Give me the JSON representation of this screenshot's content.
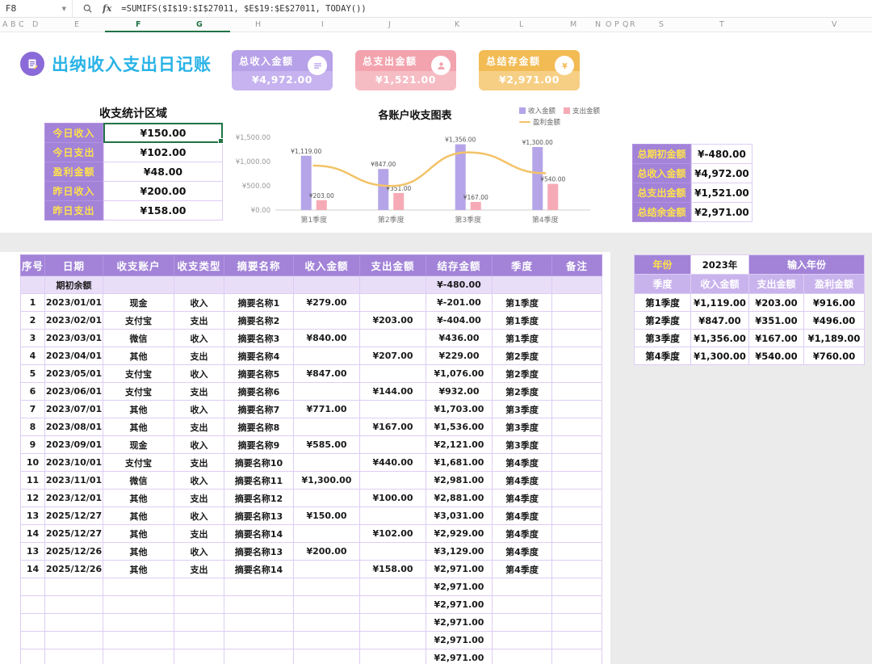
{
  "formula_bar": {
    "cell_ref": "F8",
    "formula": "=SUMIFS($I$19:$I$27011, $E$19:$E$27011, TODAY())"
  },
  "column_letters": [
    "A",
    "B",
    "C",
    "D",
    "E",
    "F",
    "G",
    "H",
    "I",
    "J",
    "K",
    "L",
    "M",
    "N",
    "O",
    "P",
    "Q",
    "R",
    "S",
    "T",
    "V"
  ],
  "selected_columns": [
    "F",
    "G"
  ],
  "title": "出纳收入支出日记账",
  "theme": {
    "header_purple": "#a283d8",
    "label_yellow": "#ffe14d",
    "selection_green": "#217346",
    "title_cyan": "#29b3e6",
    "light_purple_border": "#ddcdf4",
    "light_purple_row": "#e9def8"
  },
  "summary_cards": [
    {
      "label": "总收入金额",
      "value": "¥4,972.00",
      "color": "#b7a1e8",
      "color2": "#c6b3ef",
      "icon": "list-icon"
    },
    {
      "label": "总支出金额",
      "value": "¥1,521.00",
      "color": "#f2a3ae",
      "color2": "#f6bcc4",
      "icon": "person-icon"
    },
    {
      "label": "总结存金额",
      "value": "¥2,971.00",
      "color": "#f2bb54",
      "color2": "#f6cf85",
      "icon": "money-icon"
    }
  ],
  "stats": {
    "title": "收支统计区域",
    "rows": [
      {
        "label": "今日收入",
        "value": "¥150.00",
        "selected": true
      },
      {
        "label": "今日支出",
        "value": "¥102.00",
        "selected": false
      },
      {
        "label": "盈利金额",
        "value": "¥48.00",
        "selected": false
      },
      {
        "label": "昨日收入",
        "value": "¥200.00",
        "selected": false
      },
      {
        "label": "昨日支出",
        "value": "¥158.00",
        "selected": false
      }
    ]
  },
  "chart_data": {
    "type": "bar",
    "title": "各账户收支图表",
    "categories": [
      "第1季度",
      "第2季度",
      "第3季度",
      "第4季度"
    ],
    "series": [
      {
        "name": "收入金额",
        "kind": "bar",
        "color": "#b5a5e8",
        "values": [
          1119,
          847,
          1356,
          1300
        ],
        "labels": [
          "¥1,119.00",
          "¥847.00",
          "¥1,356.00",
          "¥1,300.00"
        ]
      },
      {
        "name": "支出金额",
        "kind": "bar",
        "color": "#f6aab6",
        "values": [
          203,
          351,
          167,
          540
        ],
        "labels": [
          "¥203.00",
          "¥351.00",
          "¥167.00",
          "¥540.00"
        ]
      },
      {
        "name": "盈利金额",
        "kind": "line",
        "color": "#f3c368",
        "values": [
          916,
          496,
          1189,
          760
        ]
      }
    ],
    "y_ticks": [
      "¥1,500.00",
      "¥1,000.00",
      "¥500.00",
      "¥0.00"
    ],
    "y_tick_values": [
      1500,
      1000,
      500,
      0
    ],
    "ylim": [
      0,
      1500
    ],
    "legend_position": "top-right",
    "grid": false
  },
  "totals_table": {
    "rows": [
      {
        "label": "总期初金额",
        "value": "¥-480.00"
      },
      {
        "label": "总收入金额",
        "value": "¥4,972.00"
      },
      {
        "label": "总支出金额",
        "value": "¥1,521.00"
      },
      {
        "label": "总结余金额",
        "value": "¥2,971.00"
      }
    ]
  },
  "quarter_table": {
    "year_label": "年份",
    "year_value": "2023年",
    "input_label": "输入年份",
    "headers": [
      "季度",
      "收入金额",
      "支出金额",
      "盈利金额"
    ],
    "rows": [
      [
        "第1季度",
        "¥1,119.00",
        "¥203.00",
        "¥916.00"
      ],
      [
        "第2季度",
        "¥847.00",
        "¥351.00",
        "¥496.00"
      ],
      [
        "第3季度",
        "¥1,356.00",
        "¥167.00",
        "¥1,189.00"
      ],
      [
        "第4季度",
        "¥1,300.00",
        "¥540.00",
        "¥760.00"
      ]
    ]
  },
  "main_table": {
    "headers": [
      "序号",
      "日期",
      "收支账户",
      "收支类型",
      "摘要名称",
      "收入金额",
      "支出金额",
      "结存金额",
      "季度",
      "备注"
    ],
    "opening_row": {
      "label": "期初余额",
      "balance": "¥-480.00"
    },
    "rows": [
      [
        "1",
        "2023/01/01",
        "现金",
        "收入",
        "摘要名称1",
        "¥279.00",
        "",
        "¥-201.00",
        "第1季度",
        ""
      ],
      [
        "2",
        "2023/02/01",
        "支付宝",
        "支出",
        "摘要名称2",
        "",
        "¥203.00",
        "¥-404.00",
        "第1季度",
        ""
      ],
      [
        "3",
        "2023/03/01",
        "微信",
        "收入",
        "摘要名称3",
        "¥840.00",
        "",
        "¥436.00",
        "第1季度",
        ""
      ],
      [
        "4",
        "2023/04/01",
        "其他",
        "支出",
        "摘要名称4",
        "",
        "¥207.00",
        "¥229.00",
        "第2季度",
        ""
      ],
      [
        "5",
        "2023/05/01",
        "支付宝",
        "收入",
        "摘要名称5",
        "¥847.00",
        "",
        "¥1,076.00",
        "第2季度",
        ""
      ],
      [
        "6",
        "2023/06/01",
        "支付宝",
        "支出",
        "摘要名称6",
        "",
        "¥144.00",
        "¥932.00",
        "第2季度",
        ""
      ],
      [
        "7",
        "2023/07/01",
        "其他",
        "收入",
        "摘要名称7",
        "¥771.00",
        "",
        "¥1,703.00",
        "第3季度",
        ""
      ],
      [
        "8",
        "2023/08/01",
        "其他",
        "支出",
        "摘要名称8",
        "",
        "¥167.00",
        "¥1,536.00",
        "第3季度",
        ""
      ],
      [
        "9",
        "2023/09/01",
        "现金",
        "收入",
        "摘要名称9",
        "¥585.00",
        "",
        "¥2,121.00",
        "第3季度",
        ""
      ],
      [
        "10",
        "2023/10/01",
        "支付宝",
        "支出",
        "摘要名称10",
        "",
        "¥440.00",
        "¥1,681.00",
        "第4季度",
        ""
      ],
      [
        "11",
        "2023/11/01",
        "微信",
        "收入",
        "摘要名称11",
        "¥1,300.00",
        "",
        "¥2,981.00",
        "第4季度",
        ""
      ],
      [
        "12",
        "2023/12/01",
        "其他",
        "支出",
        "摘要名称12",
        "",
        "¥100.00",
        "¥2,881.00",
        "第4季度",
        ""
      ],
      [
        "13",
        "2025/12/27",
        "其他",
        "收入",
        "摘要名称13",
        "¥150.00",
        "",
        "¥3,031.00",
        "第4季度",
        ""
      ],
      [
        "14",
        "2025/12/27",
        "其他",
        "支出",
        "摘要名称14",
        "",
        "¥102.00",
        "¥2,929.00",
        "第4季度",
        ""
      ],
      [
        "13",
        "2025/12/26",
        "其他",
        "收入",
        "摘要名称13",
        "¥200.00",
        "",
        "¥3,129.00",
        "第4季度",
        ""
      ],
      [
        "14",
        "2025/12/26",
        "其他",
        "支出",
        "摘要名称14",
        "",
        "¥158.00",
        "¥2,971.00",
        "第4季度",
        ""
      ]
    ],
    "trailing_balance": "¥2,971.00",
    "trailing_rows": 5
  }
}
